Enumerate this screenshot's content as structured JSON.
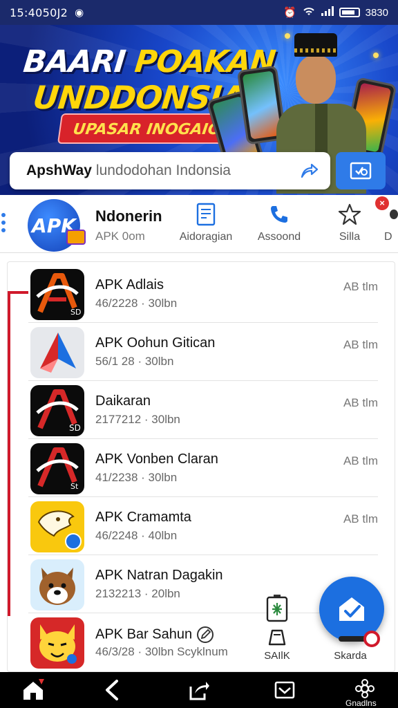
{
  "status_bar": {
    "time": "15:4050J2",
    "right_text": "3830"
  },
  "banner": {
    "headline_line1_white": "BAARI",
    "headline_line1_yellow": "POAKAN",
    "headline_line2": "UNDDONSIAN",
    "pill_text": "UPASAR INOGAION"
  },
  "search": {
    "brand": "ApshWay",
    "value": "lundodohan Indonsia"
  },
  "quick_bar": {
    "title": "Ndonerin",
    "subtitle": "APK 0om",
    "items": [
      {
        "label": "Aidoragian",
        "icon": "document-icon"
      },
      {
        "label": "Assoond",
        "icon": "phone-icon"
      },
      {
        "label": "Silla",
        "icon": "star-icon"
      },
      {
        "label": "D",
        "icon": "more-icon"
      }
    ],
    "close_badge": "×"
  },
  "apps": [
    {
      "name": "APK Adlais",
      "meta": "46/2228 · 30lbn",
      "size": "AB tlm",
      "icon_style": "black-a"
    },
    {
      "name": "APK Oohun Gitican",
      "meta": "56/1 28 · 30lbn",
      "size": "AB tlm",
      "icon_style": "grey-arrow"
    },
    {
      "name": "Daikaran",
      "meta": "2177212 · 30lbn",
      "size": "AB tlm",
      "icon_style": "black-a"
    },
    {
      "name": "APK Vonben Claran",
      "meta": "41/2238 · 30lbn",
      "size": "AB tlm",
      "icon_style": "black-a"
    },
    {
      "name": "APK Cramamta",
      "meta": "46/2248 · 40lbn",
      "size": "AB tlm",
      "icon_style": "yellow-lion"
    },
    {
      "name": "APK Natran Dagakin",
      "meta": "2132213 · 20lbn",
      "size": "",
      "icon_style": "dog"
    },
    {
      "name": "APK Bar Sahun",
      "meta": "46/3/28 · 30lbn Scyklnum",
      "size": "",
      "icon_style": "red-fox"
    }
  ],
  "floating": {
    "silk_label": "SAIlK",
    "skarda_label": "Skarda"
  },
  "bottom_nav": {
    "last_label": "Gnadlns"
  },
  "colors": {
    "primary_blue": "#1c6fe0",
    "banner_dark": "#0c1f7a",
    "accent_yellow": "#ffd60a",
    "accent_red": "#d0192b"
  }
}
